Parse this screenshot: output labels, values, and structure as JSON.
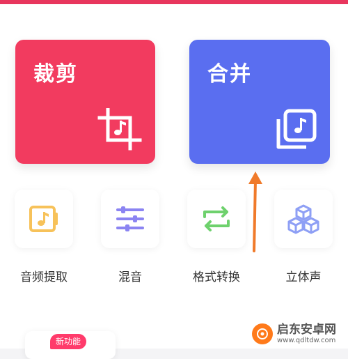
{
  "colors": {
    "top_accent": "#e8365d",
    "crop_card": "#f23b5f",
    "merge_card": "#5a6ef0",
    "extract_icon": "#f7c25a",
    "mix_icon": "#8b84f2",
    "convert_icon": "#6ed16d",
    "stereo_icon": "#8e9ff5",
    "arrow": "#f07a2a",
    "badge": "#ff3b6b"
  },
  "cards": {
    "crop": {
      "label": "裁剪",
      "icon": "crop-music-icon"
    },
    "merge": {
      "label": "合并",
      "icon": "merge-music-icon"
    }
  },
  "tools": [
    {
      "label": "音频提取",
      "icon": "audio-extract-icon"
    },
    {
      "label": "混音",
      "icon": "mixer-sliders-icon"
    },
    {
      "label": "格式转换",
      "icon": "format-convert-icon"
    },
    {
      "label": "立体声",
      "icon": "stereo-cubes-icon"
    }
  ],
  "bottom": {
    "badge": "新功能"
  },
  "watermark": {
    "name": "启东安卓网",
    "url": "www.qdltdw.com"
  }
}
